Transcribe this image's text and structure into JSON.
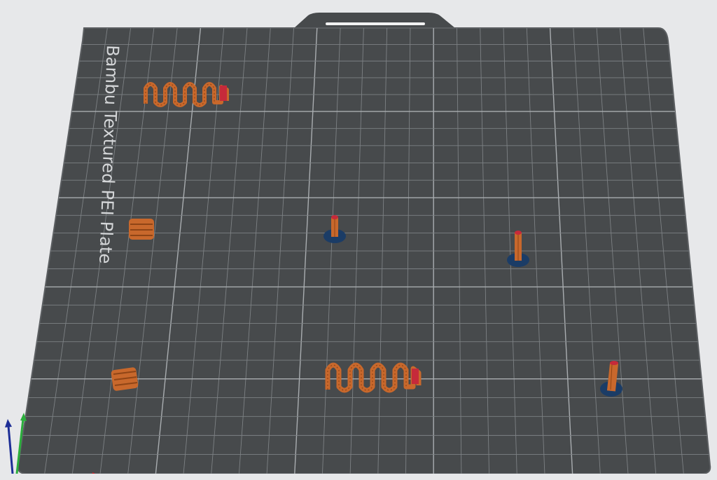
{
  "plate": {
    "name": "Bambu Textured PEI Plate",
    "color": "#474a4c",
    "grid_color": "#8e9396",
    "edge_color": "#5b5e61"
  },
  "objects": [
    {
      "name": "spring-model-top-left",
      "kind": "spring"
    },
    {
      "name": "coil-small-left",
      "kind": "coil"
    },
    {
      "name": "pin-center",
      "kind": "pin"
    },
    {
      "name": "pin-right",
      "kind": "pin"
    },
    {
      "name": "coil-small-bottom-left",
      "kind": "coil"
    },
    {
      "name": "spring-model-bottom-center",
      "kind": "spring"
    },
    {
      "name": "pin-bottom-right",
      "kind": "pin"
    }
  ],
  "colors": {
    "model_orange": "#c8682c",
    "model_dark": "#8f4516",
    "model_tip": "#c62a3a",
    "pin_base": "#1b3c66",
    "axis_x": "#d2202a",
    "axis_y": "#2bae3c",
    "axis_z": "#1d2e96"
  },
  "axes": {
    "x": "x-axis",
    "y": "y-axis",
    "z": "z-axis"
  }
}
